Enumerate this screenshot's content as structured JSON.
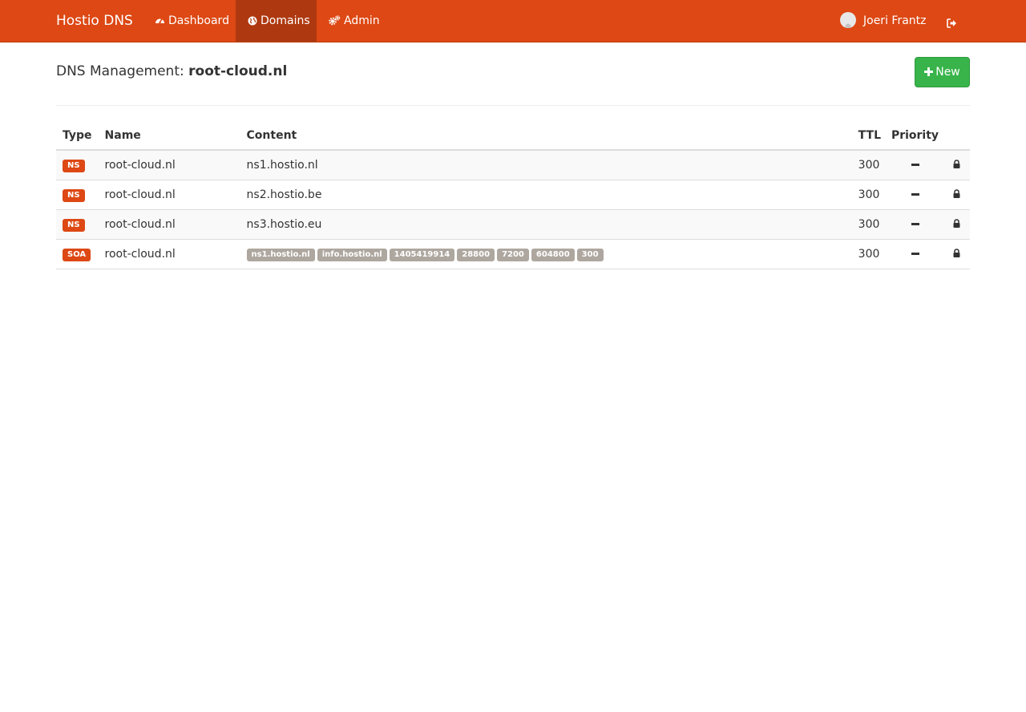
{
  "navbar": {
    "brand": "Hostio DNS",
    "items": [
      {
        "label": "Dashboard",
        "icon": "dashboard-icon"
      },
      {
        "label": "Domains",
        "icon": "globe-icon",
        "active": true
      },
      {
        "label": "Admin",
        "icon": "cogs-icon"
      }
    ],
    "user_name": "Joeri Frantz",
    "signout_icon": "sign-out-icon"
  },
  "colors": {
    "brand": "#dd4814",
    "nav_active": "#ae3910",
    "new_button": "#38b44a",
    "content_chip": "#aea79f"
  },
  "header": {
    "title_prefix": "DNS Management:",
    "domain": "root-cloud.nl",
    "new_button_label": "New"
  },
  "table": {
    "columns": [
      "Type",
      "Name",
      "Content",
      "TTL",
      "Priority"
    ],
    "rows": [
      {
        "type": "NS",
        "name": "root-cloud.nl",
        "content": "ns1.hostio.nl",
        "ttl": "300"
      },
      {
        "type": "NS",
        "name": "root-cloud.nl",
        "content": "ns2.hostio.be",
        "ttl": "300"
      },
      {
        "type": "NS",
        "name": "root-cloud.nl",
        "content": "ns3.hostio.eu",
        "ttl": "300"
      },
      {
        "type": "SOA",
        "name": "root-cloud.nl",
        "content_parts": [
          "ns1.hostio.nl",
          "info.hostio.nl",
          "1405419914",
          "28800",
          "7200",
          "604800",
          "300"
        ],
        "ttl": "300"
      }
    ]
  }
}
